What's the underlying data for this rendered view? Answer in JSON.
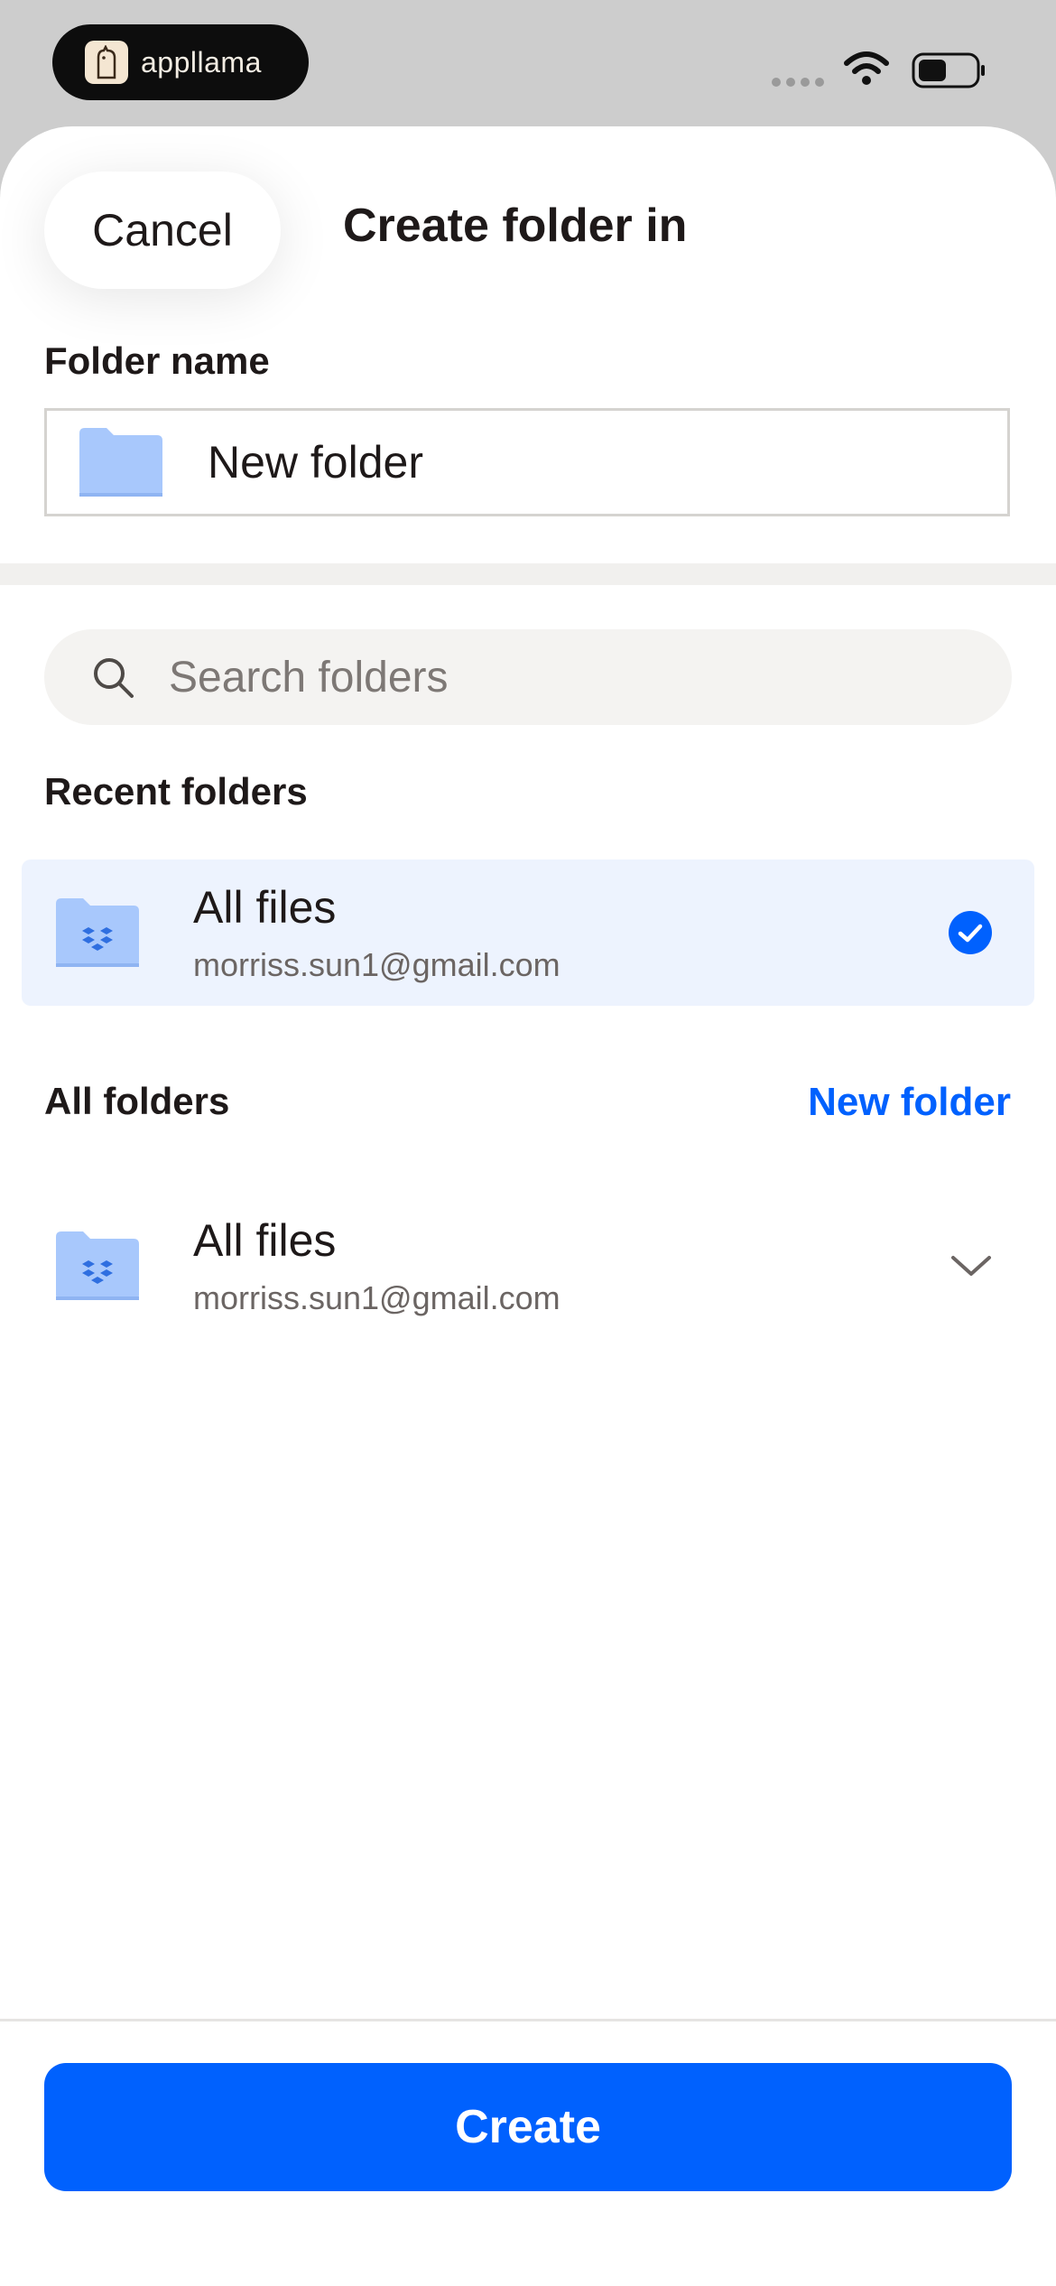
{
  "status_bar": {
    "app_badge": "appllama"
  },
  "sheet": {
    "cancel_label": "Cancel",
    "title": "Create folder in"
  },
  "folder_name": {
    "label": "Folder name",
    "value": "New folder"
  },
  "search": {
    "placeholder": "Search folders"
  },
  "recent": {
    "heading": "Recent folders",
    "items": [
      {
        "title": "All files",
        "subtitle": "morriss.sun1@gmail.com",
        "selected": true
      }
    ]
  },
  "all_folders": {
    "heading": "All folders",
    "new_folder_label": "New folder",
    "items": [
      {
        "title": "All files",
        "subtitle": "morriss.sun1@gmail.com"
      }
    ]
  },
  "footer": {
    "create_label": "Create"
  },
  "colors": {
    "accent": "#0061fe",
    "folder": "#a8c8fc",
    "selected_row": "#edf3fe"
  }
}
